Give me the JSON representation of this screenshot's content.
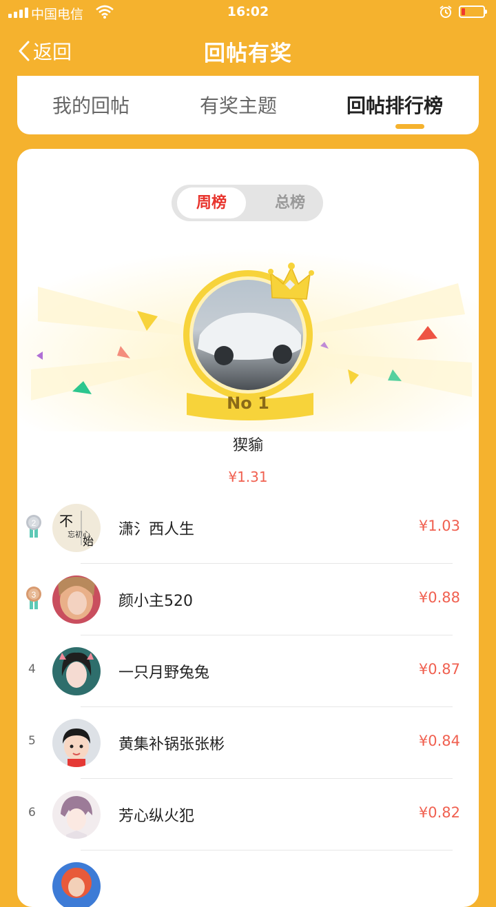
{
  "status_bar": {
    "carrier": "中国电信",
    "time": "16:02"
  },
  "nav": {
    "back_label": "返回",
    "title": "回帖有奖"
  },
  "tabs": [
    {
      "label": "我的回帖",
      "active": false
    },
    {
      "label": "有奖主题",
      "active": false
    },
    {
      "label": "回帖排行榜",
      "active": true
    }
  ],
  "toggle": {
    "weekly": "周榜",
    "total": "总榜",
    "selected": "周榜"
  },
  "winner": {
    "badge": "No 1",
    "name": "猰貐",
    "amount": "¥1.31"
  },
  "ranking": [
    {
      "rank": "2",
      "name": "潇氵西人生",
      "amount": "¥1.03"
    },
    {
      "rank": "3",
      "name": "颜小主520",
      "amount": "¥0.88"
    },
    {
      "rank": "4",
      "name": "一只月野兔兔",
      "amount": "¥0.87"
    },
    {
      "rank": "5",
      "name": "黄集补锅张张彬",
      "amount": "¥0.84"
    },
    {
      "rank": "6",
      "name": "芳心纵火犯",
      "amount": "¥0.82"
    }
  ],
  "colors": {
    "brand": "#F5B22E",
    "accent": "#E8332C",
    "amount": "#F06050",
    "crown": "#F7D33A"
  }
}
